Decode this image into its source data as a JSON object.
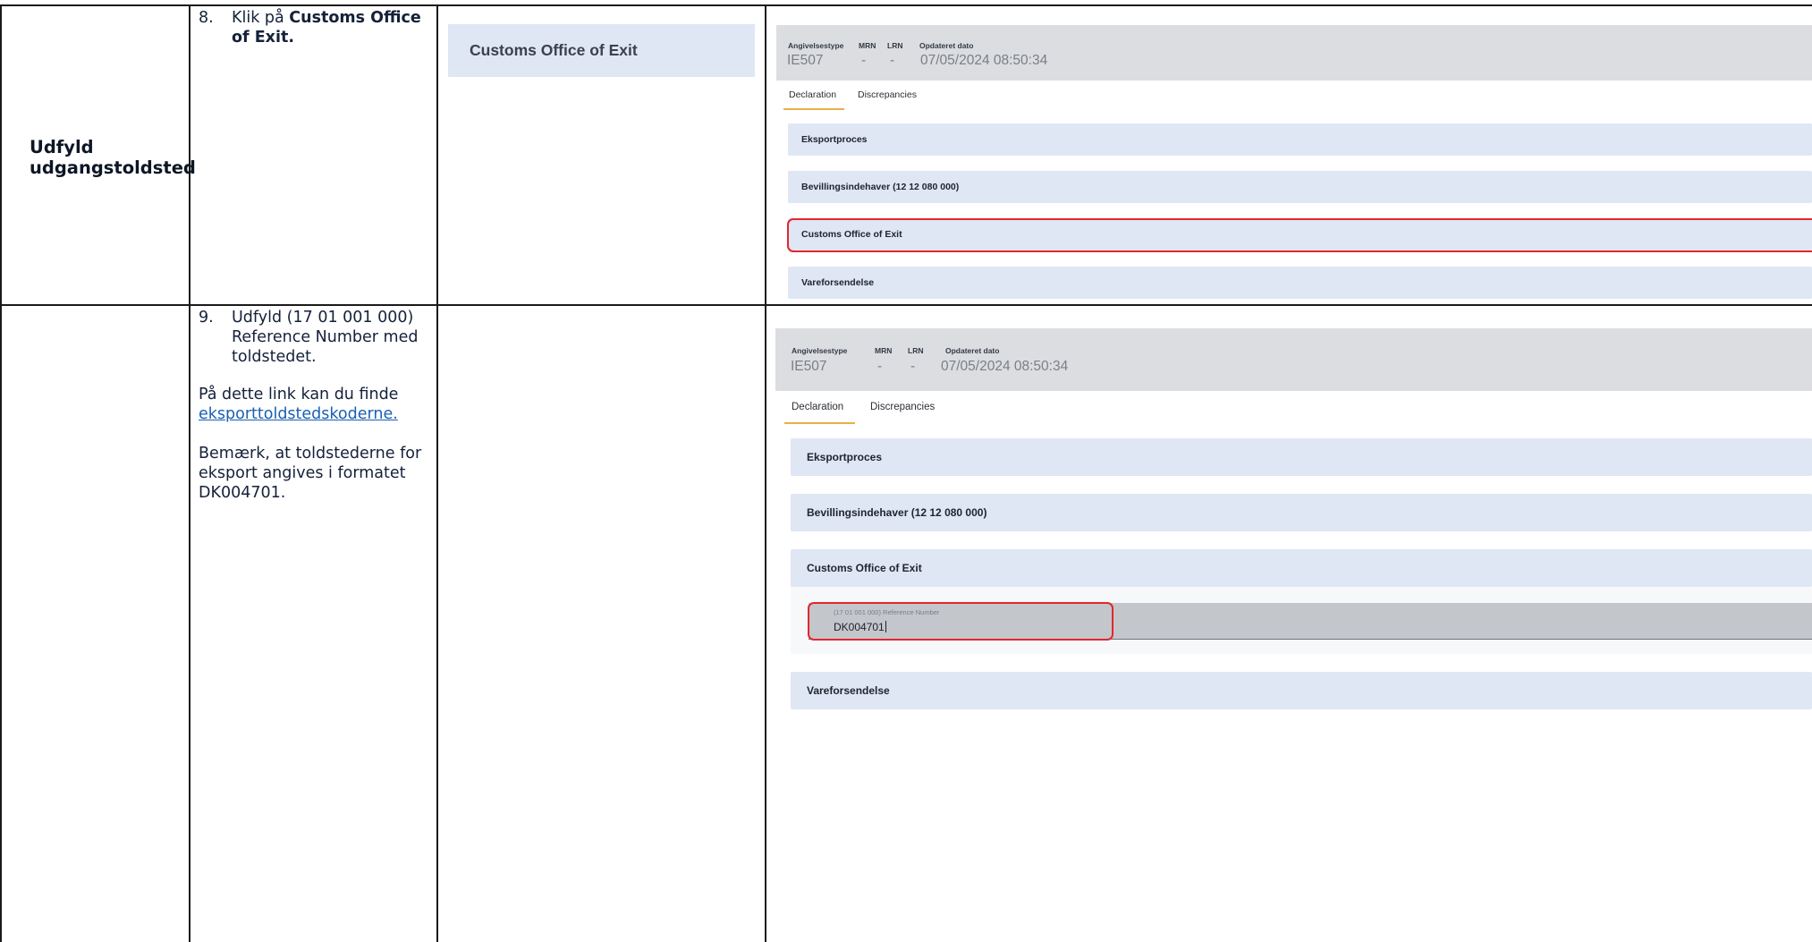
{
  "section": {
    "title_line1": "Udfyld",
    "title_line2": "udgangstoldsted"
  },
  "step8": {
    "number": "8.",
    "text_prefix": "Klik på ",
    "text_bold_line1": "Customs Office",
    "text_bold_line2": "of Exit."
  },
  "step9": {
    "number": "9.",
    "line1": "Udfyld (17 01 001 000)",
    "line2": "Reference Number med",
    "line3": "toldstedet.",
    "para1_line1": "På dette link kan du finde",
    "para1_link": "eksporttoldstedskoderne.",
    "para2_line1": "Bemærk, at toldstederne for",
    "para2_line2": "eksport angives i formatet",
    "para2_line3": "DK004701."
  },
  "callout": {
    "label": "Customs Office of Exit"
  },
  "screenshot": {
    "header": {
      "type_label": "Angivelsestype",
      "type_value": "IE507",
      "mrn_label": "MRN",
      "mrn_value": "-",
      "lrn_label": "LRN",
      "lrn_value": "-",
      "date_label": "Opdateret dato",
      "date_value": "07/05/2024 08:50:34"
    },
    "tabs": [
      "Declaration",
      "Discrepancies"
    ],
    "sections": [
      "Eksportproces",
      "Bevillingsindehaver (12 12 080 000)",
      "Customs Office of Exit",
      "Vareforsendelse"
    ],
    "field": {
      "label": "(17 01 001 000) Reference Number",
      "value": "DK004701"
    }
  },
  "colors": {
    "highlight": "#e3262d",
    "accordion": "#dfe6f4",
    "header_bg": "#dbdde1",
    "tab_underline": "#e8b04a",
    "link": "#1a5fb4"
  }
}
